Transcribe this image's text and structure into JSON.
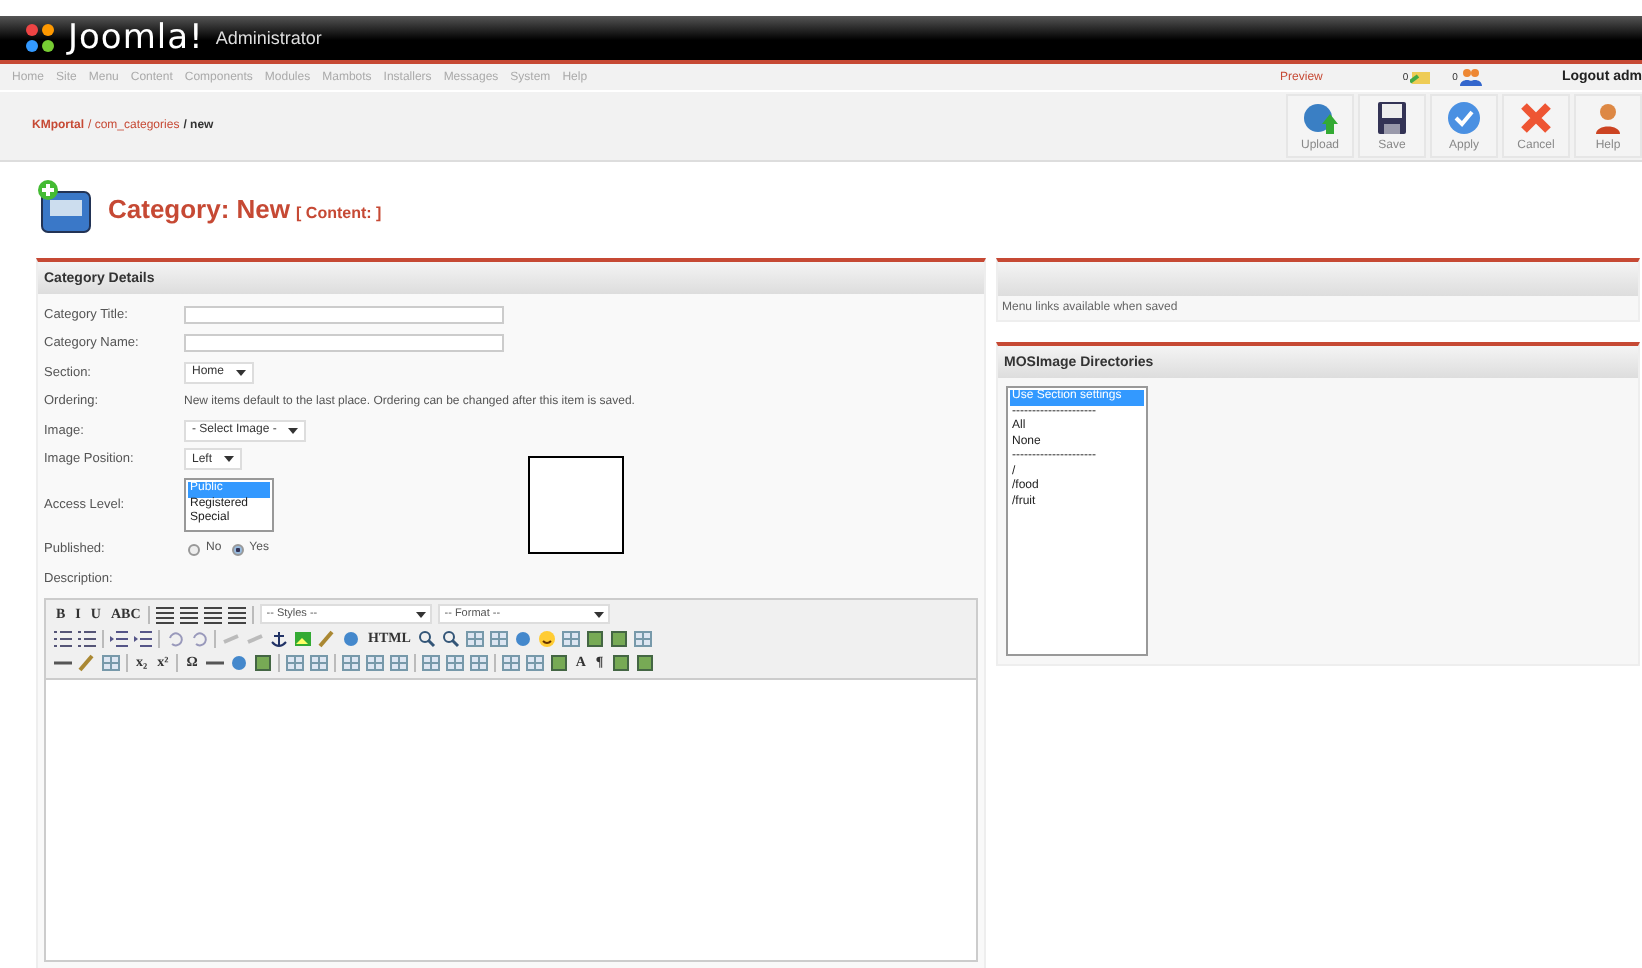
{
  "header": {
    "logo": "Joomla!",
    "subtitle": "Administrator"
  },
  "menu": [
    "Home",
    "Site",
    "Menu",
    "Content",
    "Components",
    "Modules",
    "Mambots",
    "Installers",
    "Messages",
    "System",
    "Help"
  ],
  "status": {
    "preview": "Preview",
    "messages": "0",
    "users": "0",
    "logout": "Logout adm"
  },
  "breadcrumb": [
    {
      "text": "KMportal",
      "kind": "strong"
    },
    {
      "text": "/ com_categories",
      "kind": "link"
    },
    {
      "text": "/ new",
      "kind": "current"
    }
  ],
  "toolbar": [
    {
      "label": "Upload",
      "kind": "upload"
    },
    {
      "label": "Save",
      "kind": "save"
    },
    {
      "label": "Apply",
      "kind": "apply"
    },
    {
      "label": "Cancel",
      "kind": "cancel"
    },
    {
      "label": "Help",
      "kind": "help"
    }
  ],
  "page_title": {
    "title": "Category: New",
    "context": "[ Content: ]"
  },
  "details": {
    "heading": "Category Details",
    "fields": [
      {
        "label": "Category Title:",
        "kind": "text"
      },
      {
        "label": "Category Name:",
        "kind": "text"
      },
      {
        "label": "Section:",
        "kind": "select",
        "value": "Home"
      },
      {
        "label": "Ordering:",
        "kind": "note",
        "value": "New items default to the last place. Ordering can be changed after this item is saved."
      },
      {
        "label": "Image:",
        "kind": "select",
        "value": "- Select Image -"
      },
      {
        "label": "Image Position:",
        "kind": "select",
        "value": "Left"
      },
      {
        "label": "Access Level:",
        "kind": "listbox",
        "options": [
          {
            "label": "Public",
            "selected": true
          },
          {
            "label": "Registered",
            "selected": false
          },
          {
            "label": "Special",
            "selected": false
          }
        ]
      },
      {
        "label": "Published:",
        "kind": "radio",
        "options": [
          {
            "label": "No",
            "selected": false
          },
          {
            "label": "Yes",
            "selected": true
          }
        ]
      },
      {
        "label": "Description:",
        "kind": "label"
      }
    ]
  },
  "editor": {
    "rows": [
      [
        {
          "kind": "text",
          "label": "B"
        },
        {
          "kind": "text",
          "label": "I"
        },
        {
          "kind": "text",
          "label": "U"
        },
        {
          "kind": "text",
          "label": "ABC"
        },
        {
          "kind": "sep"
        },
        {
          "kind": "align"
        },
        {
          "kind": "align"
        },
        {
          "kind": "align"
        },
        {
          "kind": "align"
        },
        {
          "kind": "sep"
        },
        {
          "kind": "select",
          "label": "-- Styles --"
        },
        {
          "kind": "select",
          "label": "-- Format --"
        }
      ],
      [
        {
          "kind": "list"
        },
        {
          "kind": "list"
        },
        {
          "kind": "sep"
        },
        {
          "kind": "indent"
        },
        {
          "kind": "indent"
        },
        {
          "kind": "sep"
        },
        {
          "kind": "undo"
        },
        {
          "kind": "undo"
        },
        {
          "kind": "sep"
        },
        {
          "kind": "link"
        },
        {
          "kind": "link"
        },
        {
          "kind": "anchor"
        },
        {
          "kind": "image"
        },
        {
          "kind": "brush"
        },
        {
          "kind": "circle"
        },
        {
          "kind": "text",
          "label": "HTML"
        },
        {
          "kind": "search"
        },
        {
          "kind": "search"
        },
        {
          "kind": "grid"
        },
        {
          "kind": "grid"
        },
        {
          "kind": "circle"
        },
        {
          "kind": "emoji"
        },
        {
          "kind": "grid"
        },
        {
          "kind": "square"
        },
        {
          "kind": "square"
        },
        {
          "kind": "grid"
        }
      ],
      [
        {
          "kind": "line"
        },
        {
          "kind": "brush"
        },
        {
          "kind": "grid"
        },
        {
          "kind": "sep"
        },
        {
          "kind": "text",
          "label": "x₂"
        },
        {
          "kind": "text",
          "label": "x²"
        },
        {
          "kind": "sep"
        },
        {
          "kind": "text",
          "label": "Ω"
        },
        {
          "kind": "line"
        },
        {
          "kind": "circle"
        },
        {
          "kind": "square"
        },
        {
          "kind": "sep"
        },
        {
          "kind": "grid"
        },
        {
          "kind": "grid"
        },
        {
          "kind": "sep"
        },
        {
          "kind": "grid"
        },
        {
          "kind": "grid"
        },
        {
          "kind": "grid"
        },
        {
          "kind": "sep"
        },
        {
          "kind": "grid"
        },
        {
          "kind": "grid"
        },
        {
          "kind": "grid"
        },
        {
          "kind": "sep"
        },
        {
          "kind": "grid"
        },
        {
          "kind": "grid"
        },
        {
          "kind": "square"
        },
        {
          "kind": "text",
          "label": "A"
        },
        {
          "kind": "text",
          "label": "¶"
        },
        {
          "kind": "square"
        },
        {
          "kind": "square"
        }
      ]
    ]
  },
  "menu_links": {
    "text": "Menu links available when saved"
  },
  "mosimage": {
    "heading": "MOSImage Directories",
    "options": [
      {
        "label": "Use Section settings",
        "selected": true
      },
      {
        "label": "---------------------",
        "selected": false
      },
      {
        "label": "All",
        "selected": false
      },
      {
        "label": "None",
        "selected": false
      },
      {
        "label": "---------------------",
        "selected": false
      },
      {
        "label": "/",
        "selected": false
      },
      {
        "label": "/food",
        "selected": false
      },
      {
        "label": "/fruit",
        "selected": false
      }
    ]
  }
}
